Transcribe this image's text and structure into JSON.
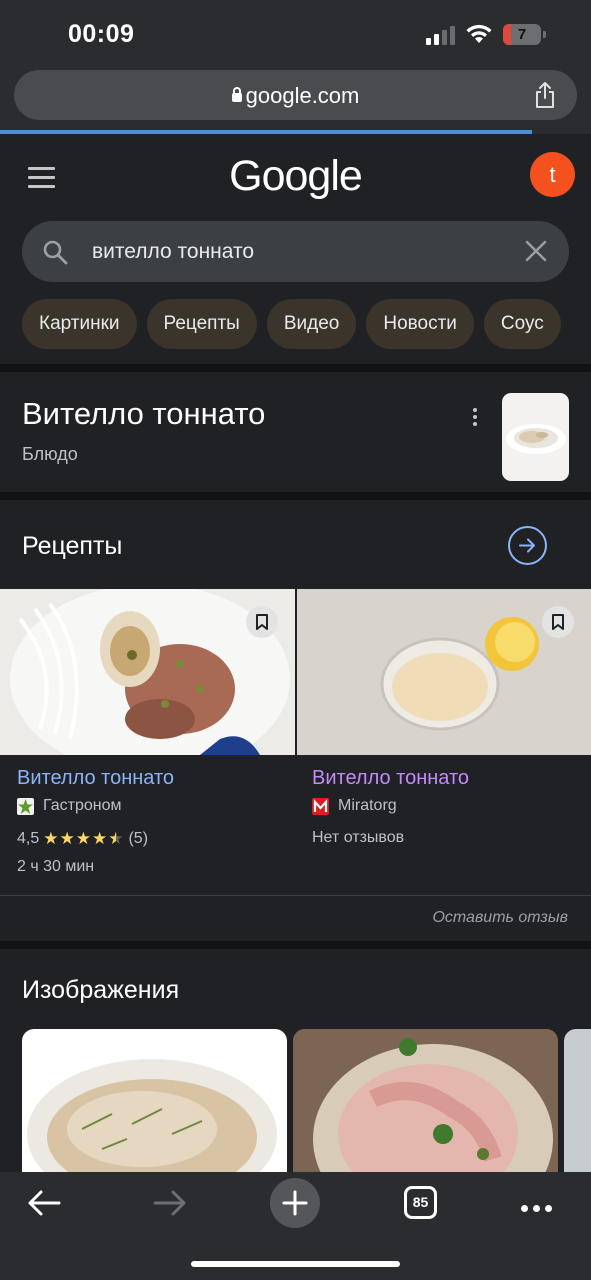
{
  "status_bar": {
    "time": "00:09",
    "battery_level": "7",
    "battery_color": "#e0483d"
  },
  "browser": {
    "url": "google.com",
    "tab_count": "85",
    "progress_percent": 90
  },
  "google": {
    "logo_text": "Google",
    "avatar_letter": "t",
    "search_query": "вителло тоннато",
    "chips": [
      "Картинки",
      "Рецепты",
      "Видео",
      "Новости",
      "Соус"
    ]
  },
  "knowledge_panel": {
    "title": "Вителло тоннато",
    "subtitle": "Блюдо"
  },
  "recipes": {
    "heading": "Рецепты",
    "items": [
      {
        "title": "Вителло тоннато",
        "source": "Гастроном",
        "rating": "4,5",
        "stars": 4.5,
        "reviews": "(5)",
        "time": "2 ч 30 мин",
        "title_color": "#8ab4f8"
      },
      {
        "title": "Вителло тоннато",
        "source": "Miratorg",
        "no_reviews": "Нет отзывов",
        "title_color": "#c58af9"
      }
    ],
    "leave_review": "Оставить отзыв"
  },
  "images": {
    "heading": "Изображения"
  },
  "icons": [
    "lock-icon",
    "share-icon",
    "menu-icon",
    "search-icon",
    "clear-icon",
    "more-icon",
    "arrow-right-icon",
    "bookmark-icon",
    "back-icon",
    "forward-icon",
    "plus-icon",
    "tabs-icon",
    "more-dots-icon"
  ]
}
